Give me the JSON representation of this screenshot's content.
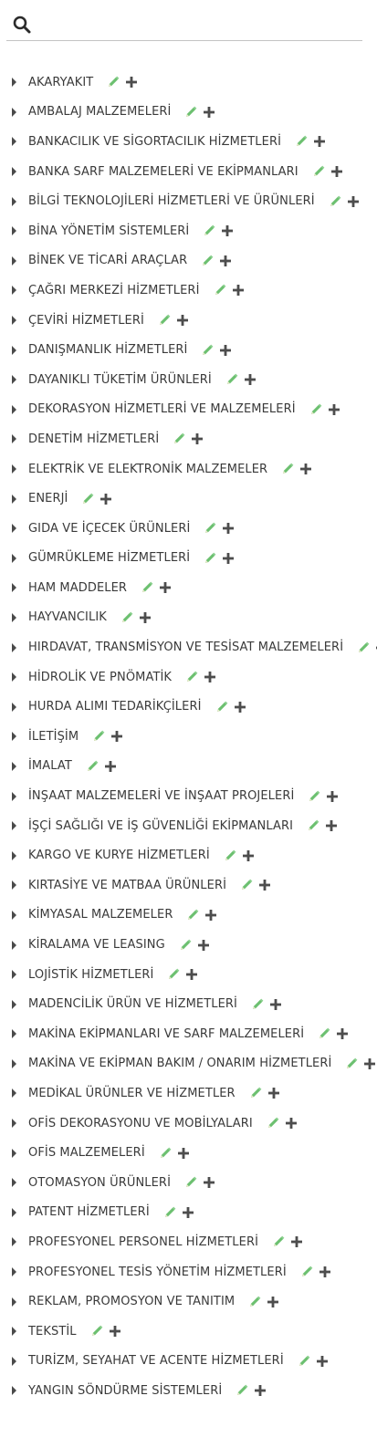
{
  "search": {
    "placeholder": ""
  },
  "colors": {
    "edit": "#6cc070",
    "add": "#4d4d4d",
    "caret": "#4a4a4a",
    "text": "#3a3a3a"
  },
  "categories": [
    "AKARYAKIT",
    "AMBALAJ MALZEMELERİ",
    "BANKACILIK VE SİGORTACILIK HİZMETLERİ",
    "BANKA SARF MALZEMELERİ VE EKİPMANLARI",
    "BİLGİ TEKNOLOJİLERİ HİZMETLERİ VE ÜRÜNLERİ",
    "BİNA YÖNETİM SİSTEMLERİ",
    "BİNEK VE TİCARİ ARAÇLAR",
    "ÇAĞRI MERKEZİ HİZMETLERİ",
    "ÇEVİRİ HİZMETLERİ",
    "DANIŞMANLIK HİZMETLERİ",
    "DAYANIKLI TÜKETİM ÜRÜNLERİ",
    "DEKORASYON HİZMETLERİ VE MALZEMELERİ",
    "DENETİM HİZMETLERİ",
    "ELEKTRİK VE ELEKTRONİK MALZEMELER",
    "ENERJİ",
    "GIDA VE İÇECEK ÜRÜNLERİ",
    "GÜMRÜKLEME HİZMETLERİ",
    "HAM MADDELER",
    "HAYVANCILIK",
    "HIRDAVAT, TRANSMİSYON VE TESİSAT MALZEMELERİ",
    "HİDROLİK VE PNÖMATİK",
    "HURDA ALIMI TEDARİKÇİLERİ",
    "İLETİŞİM",
    "İMALAT",
    "İNŞAAT MALZEMELERİ VE İNŞAAT PROJELERİ",
    "İŞÇİ SAĞLIĞI VE İŞ GÜVENLİĞİ EKİPMANLARI",
    "KARGO VE KURYE HİZMETLERİ",
    "KIRTASİYE VE MATBAA ÜRÜNLERİ",
    "KİMYASAL MALZEMELER",
    "KİRALAMA VE LEASING",
    "LOJİSTİK HİZMETLERİ",
    "MADENCİLİK ÜRÜN VE HİZMETLERİ",
    "MAKİNA EKİPMANLARI VE SARF MALZEMELERİ",
    "MAKİNA VE EKİPMAN BAKIM / ONARIM HİZMETLERİ",
    "MEDİKAL ÜRÜNLER VE HİZMETLER",
    "OFİS DEKORASYONU VE MOBİLYALARI",
    "OFİS MALZEMELERİ",
    "OTOMASYON ÜRÜNLERİ",
    "PATENT HİZMETLERİ",
    "PROFESYONEL PERSONEL HİZMETLERİ",
    "PROFESYONEL TESİS YÖNETİM HİZMETLERİ",
    "REKLAM, PROMOSYON VE TANITIM",
    "TEKSTİL",
    "TURİZM, SEYAHAT VE ACENTE HİZMETLERİ",
    "YANGIN SÖNDÜRME SİSTEMLERİ"
  ]
}
